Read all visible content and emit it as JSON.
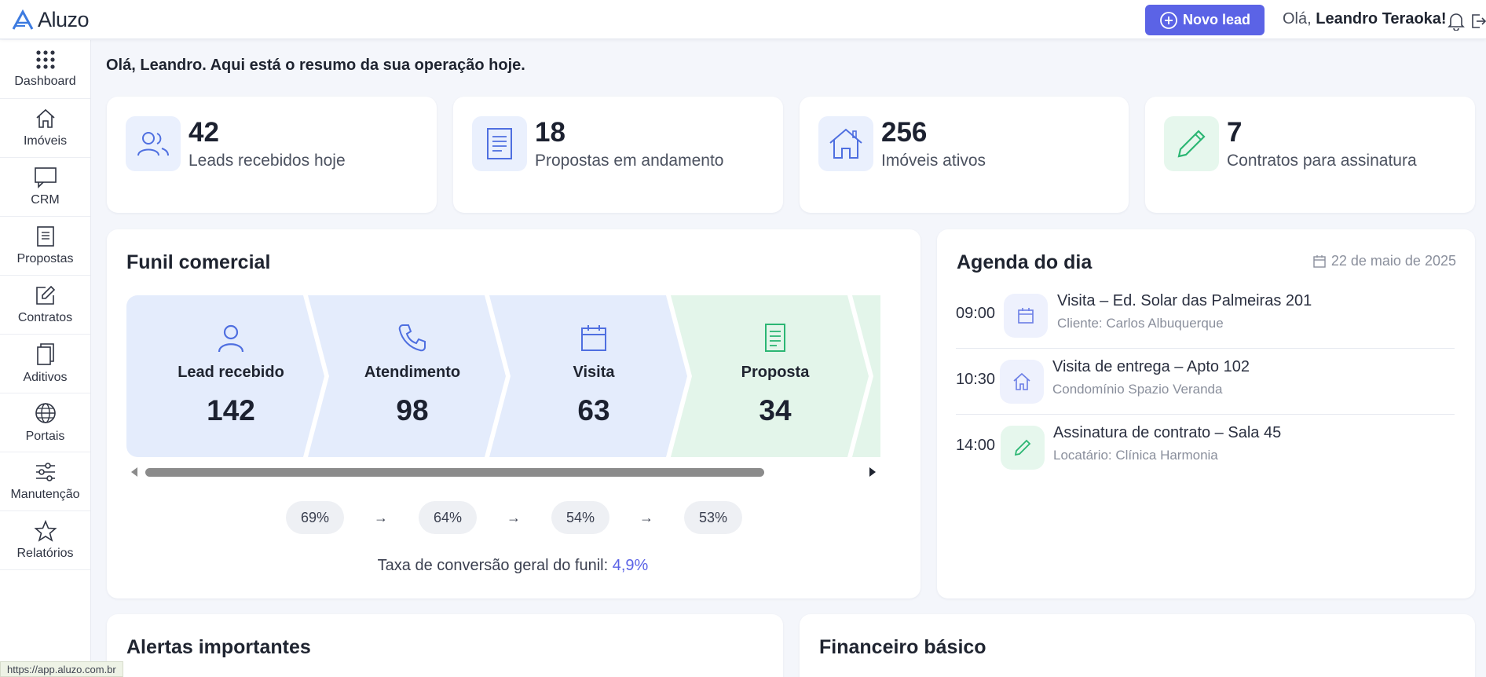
{
  "app": {
    "brand": "Aluzo"
  },
  "header": {
    "new_lead_label": "Novo lead",
    "greeting_prefix": "Olá,",
    "greeting_name": "Leandro Teraoka!"
  },
  "sidebar": {
    "items": [
      {
        "label": "Dashboard",
        "icon": "grid-icon"
      },
      {
        "label": "Imóveis",
        "icon": "home-icon"
      },
      {
        "label": "CRM",
        "icon": "chat-icon"
      },
      {
        "label": "Propostas",
        "icon": "document-icon"
      },
      {
        "label": "Contratos",
        "icon": "edit-icon"
      },
      {
        "label": "Aditivos",
        "icon": "copy-icon"
      },
      {
        "label": "Portais",
        "icon": "globe-icon"
      },
      {
        "label": "Manutenção",
        "icon": "sliders-icon"
      },
      {
        "label": "Relatórios",
        "icon": "star-icon"
      }
    ]
  },
  "welcome": "Olá, Leandro. Aqui está o resumo da sua operação hoje.",
  "stats": [
    {
      "value": "42",
      "label": "Leads recebidos hoje",
      "icon": "users-icon"
    },
    {
      "value": "18",
      "label": "Propostas em andamento",
      "icon": "document-icon"
    },
    {
      "value": "256",
      "label": "Imóveis ativos",
      "icon": "home-icon"
    },
    {
      "value": "7",
      "label": "Contratos para assinatura",
      "icon": "pen-icon"
    }
  ],
  "funnel": {
    "title": "Funil comercial",
    "stages": [
      {
        "name": "Lead recebido",
        "value": "142",
        "icon": "user-icon"
      },
      {
        "name": "Atendimento",
        "value": "98",
        "icon": "phone-icon"
      },
      {
        "name": "Visita",
        "value": "63",
        "icon": "calendar-icon"
      },
      {
        "name": "Proposta",
        "value": "34",
        "icon": "document-icon"
      }
    ],
    "rates": [
      "69%",
      "64%",
      "54%",
      "53%"
    ],
    "arrow": "→",
    "conversion_label": "Taxa de conversão geral do funil:",
    "conversion_value": "4,9%"
  },
  "agenda": {
    "title": "Agenda do dia",
    "date": "22 de maio de 2025",
    "items": [
      {
        "time": "09:00",
        "title": "Visita – Ed. Solar das Palmeiras 201",
        "sub": "Cliente: Carlos Albuquerque",
        "icon": "calendar-icon"
      },
      {
        "time": "10:30",
        "title": "Visita de entrega – Apto 102",
        "sub": "Condomínio Spazio Veranda",
        "icon": "home-icon"
      },
      {
        "time": "14:00",
        "title": "Assinatura de contrato – Sala 45",
        "sub": "Locatário: Clínica Harmonia",
        "icon": "pen-icon"
      }
    ]
  },
  "alerts": {
    "title": "Alertas importantes"
  },
  "finance": {
    "title": "Financeiro básico"
  },
  "status_url": "https://app.aluzo.com.br",
  "colors": {
    "accent": "#5b63e6",
    "green": "#2bb673",
    "blue_stage": "#e4ecfc",
    "green_stage": "#e3f5ea"
  }
}
